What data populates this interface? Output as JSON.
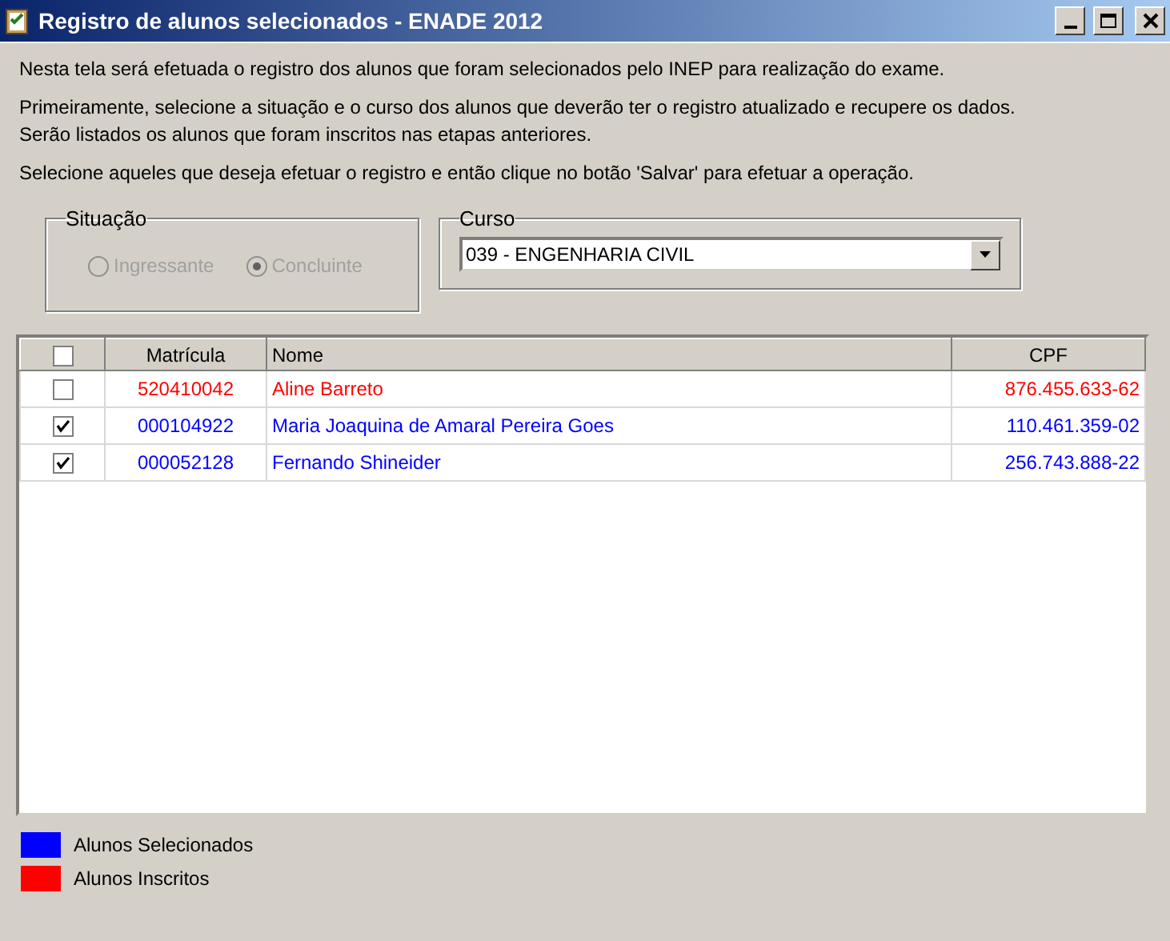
{
  "window": {
    "title": "Registro de alunos selecionados - ENADE 2012"
  },
  "intro": [
    "Nesta tela será efetuada o registro dos alunos que foram selecionados pelo INEP para realização do exame.",
    "Primeiramente, selecione a situação e o curso dos alunos que deverão ter o registro atualizado e recupere os dados.\nSerão listados os alunos que foram inscritos nas etapas anteriores.",
    "Selecione aqueles que deseja efetuar o registro e então clique no botão 'Salvar' para efetuar a operação."
  ],
  "situacao": {
    "label": "Situação",
    "options": [
      {
        "label": "Ingressante",
        "selected": false,
        "disabled": true
      },
      {
        "label": "Concluinte",
        "selected": true,
        "disabled": true
      }
    ]
  },
  "curso": {
    "label": "Curso",
    "value": "039 - ENGENHARIA CIVIL"
  },
  "table": {
    "select_all": false,
    "columns": [
      "Matrícula",
      "Nome",
      "CPF"
    ],
    "rows": [
      {
        "checked": false,
        "color": "#ff0000",
        "matricula": "520410042",
        "nome": "Aline Barreto",
        "cpf": "876.455.633-62"
      },
      {
        "checked": true,
        "color": "#0000ff",
        "matricula": "000104922",
        "nome": "Maria Joaquina de Amaral Pereira Goes",
        "cpf": "110.461.359-02"
      },
      {
        "checked": true,
        "color": "#0000ff",
        "matricula": "000052128",
        "nome": "Fernando Shineider",
        "cpf": "256.743.888-22"
      }
    ]
  },
  "legend": [
    {
      "color": "#0000ff",
      "label": "Alunos Selecionados"
    },
    {
      "color": "#ff0000",
      "label": "Alunos Inscritos"
    }
  ]
}
